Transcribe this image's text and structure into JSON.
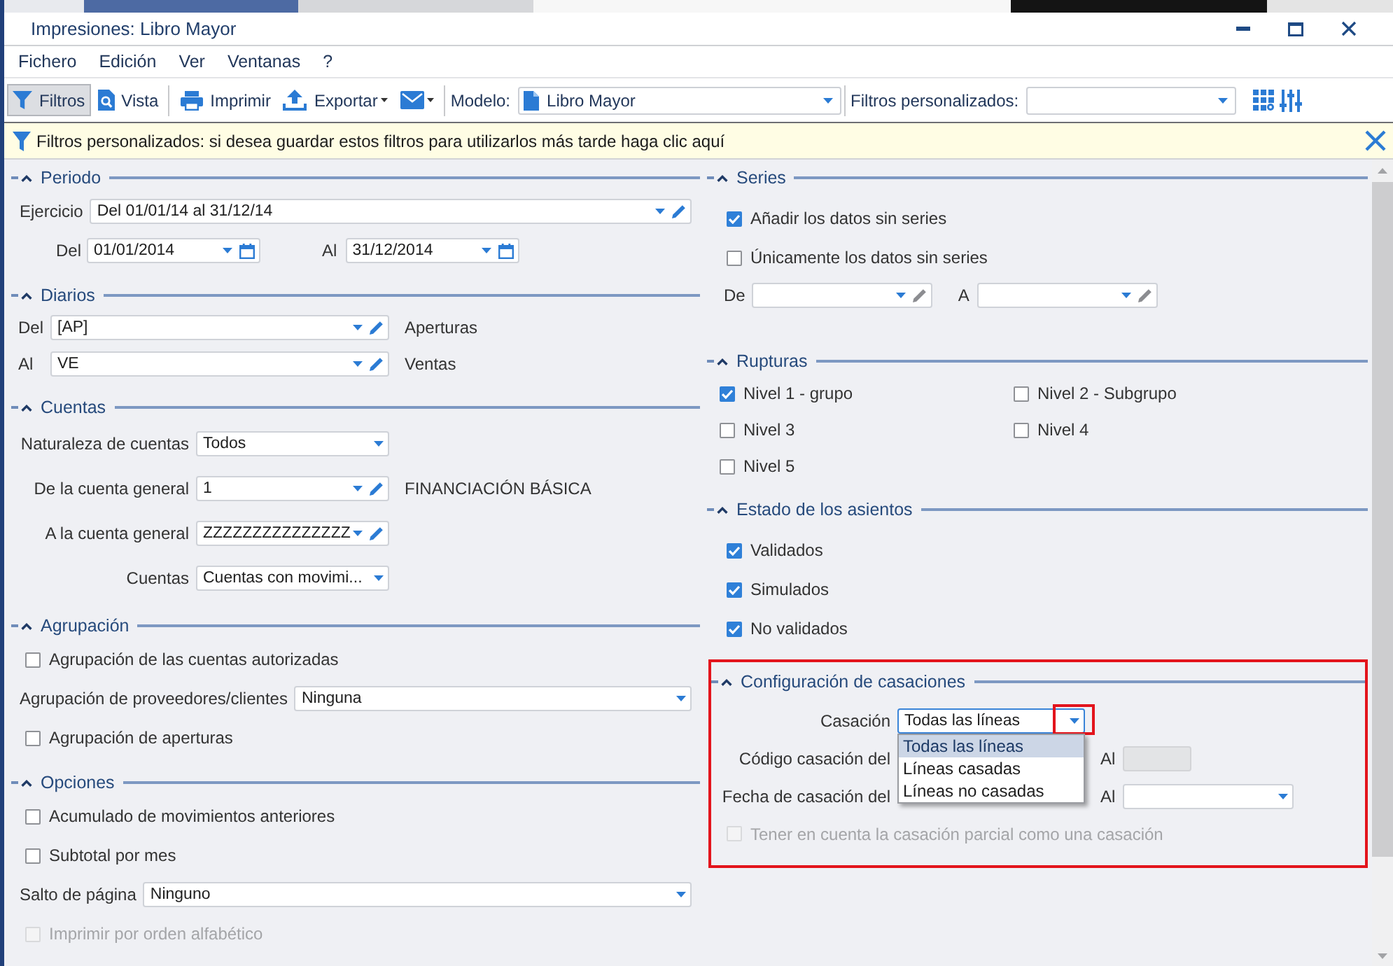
{
  "window": {
    "title": "Impresiones: Libro Mayor"
  },
  "menu": [
    "Fichero",
    "Edición",
    "Ver",
    "Ventanas",
    "?"
  ],
  "toolbar": [
    {
      "kind": "filter",
      "label": "Filtros",
      "pressed": true
    },
    {
      "kind": "preview",
      "label": "Vista",
      "pressed": false
    },
    {
      "kind": "separator"
    },
    {
      "kind": "print",
      "label": "Imprimir",
      "pressed": false
    },
    {
      "kind": "export",
      "label": "Exportar",
      "pressed": false,
      "menu": true
    },
    {
      "kind": "mail",
      "pressed": false,
      "menu": true
    },
    {
      "kind": "separator"
    },
    {
      "kind": "document-combo",
      "label": "Modelo:",
      "value": "Libro Mayor"
    },
    {
      "kind": "separator"
    },
    {
      "kind": "combo",
      "label": "Filtros personalizados:"
    },
    {
      "kind": "grid-settings"
    },
    {
      "kind": "sliders"
    }
  ],
  "info_bar": {
    "text": "Filtros personalizados: si desea guardar estos filtros para utilizarlos más tarde haga clic aquí"
  },
  "left_sections": [
    {
      "title": "Periodo",
      "expanded": true,
      "rows": [
        {
          "kind": "wide",
          "items": [
            {
              "kind": "label",
              "text": "Ejercicio"
            },
            {
              "kind": "combo-edit",
              "value": "Del 01/01/14 al 31/12/14",
              "edit_enabled": true
            }
          ]
        },
        {
          "kind": "dates",
          "items": [
            {
              "kind": "label",
              "text": "Del"
            },
            {
              "kind": "date",
              "value": "01/01/2014"
            },
            {
              "kind": "label",
              "text": "Al"
            },
            {
              "kind": "date",
              "value": "31/12/2014"
            }
          ]
        }
      ]
    },
    {
      "title": "Diarios",
      "expanded": true,
      "rows": [
        {
          "kind": "journal",
          "items": [
            {
              "kind": "label",
              "text": "Del"
            },
            {
              "kind": "combo-edit",
              "value": "[AP]",
              "edit_enabled": true
            },
            {
              "kind": "note",
              "text": "Aperturas"
            }
          ]
        },
        {
          "kind": "journal",
          "items": [
            {
              "kind": "label",
              "text": "Al"
            },
            {
              "kind": "combo-edit",
              "value": "VE",
              "edit_enabled": true
            },
            {
              "kind": "note",
              "text": "Ventas"
            }
          ]
        }
      ]
    },
    {
      "title": "Cuentas",
      "expanded": true,
      "rows": [
        {
          "kind": "account",
          "items": [
            {
              "kind": "label",
              "text": "Naturaleza de cuentas"
            },
            {
              "kind": "combo",
              "value": "Todos"
            }
          ]
        },
        {
          "kind": "account",
          "items": [
            {
              "kind": "label",
              "text": "De la cuenta general"
            },
            {
              "kind": "combo-edit",
              "value": "1",
              "edit_enabled": true
            },
            {
              "kind": "note",
              "text": "FINANCIACIÓN BÁSICA"
            }
          ]
        },
        {
          "kind": "account",
          "items": [
            {
              "kind": "label",
              "text": "A la cuenta general"
            },
            {
              "kind": "combo-edit",
              "value": "ZZZZZZZZZZZZZZZ",
              "edit_enabled": true
            }
          ]
        },
        {
          "kind": "account",
          "items": [
            {
              "kind": "label",
              "text": "Cuentas"
            },
            {
              "kind": "combo",
              "value": "Cuentas con movimi..."
            }
          ]
        }
      ]
    },
    {
      "title": "Agrupación",
      "expanded": true,
      "rows": [
        {
          "kind": "check",
          "items": [
            {
              "kind": "checkbox",
              "label": "Agrupación de las cuentas autorizadas",
              "checked": false,
              "disabled": false
            }
          ]
        },
        {
          "kind": "wide",
          "items": [
            {
              "kind": "label",
              "text": "Agrupación de proveedores/clientes"
            },
            {
              "kind": "combo",
              "value": "Ninguna"
            }
          ]
        },
        {
          "kind": "check",
          "items": [
            {
              "kind": "checkbox",
              "label": "Agrupación de aperturas",
              "checked": false,
              "disabled": false
            }
          ]
        }
      ]
    },
    {
      "title": "Opciones",
      "expanded": true,
      "rows": [
        {
          "kind": "check",
          "items": [
            {
              "kind": "checkbox",
              "label": "Acumulado de movimientos anteriores",
              "checked": false,
              "disabled": false
            }
          ]
        },
        {
          "kind": "check",
          "items": [
            {
              "kind": "checkbox",
              "label": "Subtotal por mes",
              "checked": false,
              "disabled": false
            }
          ]
        },
        {
          "kind": "wide",
          "items": [
            {
              "kind": "label",
              "text": "Salto de página"
            },
            {
              "kind": "combo",
              "value": "Ninguno"
            }
          ]
        },
        {
          "kind": "check",
          "items": [
            {
              "kind": "checkbox",
              "label": "Imprimir por orden alfabético",
              "checked": false,
              "disabled": true
            }
          ]
        }
      ]
    }
  ],
  "right_sections": [
    {
      "title": "Series",
      "expanded": true,
      "rows": [
        {
          "kind": "check",
          "items": [
            {
              "kind": "checkbox",
              "label": "Añadir los datos sin series",
              "checked": true,
              "disabled": false
            }
          ]
        },
        {
          "kind": "check",
          "items": [
            {
              "kind": "checkbox",
              "label": "Únicamente los datos sin series",
              "checked": false,
              "disabled": false
            }
          ]
        },
        {
          "kind": "range",
          "items": [
            {
              "kind": "label",
              "text": "De"
            },
            {
              "kind": "combo-edit",
              "edit_enabled": false
            },
            {
              "kind": "label",
              "text": "A"
            },
            {
              "kind": "combo-edit",
              "edit_enabled": false
            }
          ]
        }
      ]
    },
    {
      "title": "Rupturas",
      "expanded": true,
      "rows": [
        {
          "kind": "grid",
          "items": [
            {
              "kind": "checkbox",
              "label": "Nivel 1 - grupo",
              "checked": true,
              "disabled": false
            },
            {
              "kind": "checkbox",
              "label": "Nivel 2 - Subgrupo",
              "checked": false,
              "disabled": false
            },
            {
              "kind": "checkbox",
              "label": "Nivel 3",
              "checked": false,
              "disabled": false
            },
            {
              "kind": "checkbox",
              "label": "Nivel 4",
              "checked": false,
              "disabled": false
            },
            {
              "kind": "checkbox",
              "label": "Nivel 5",
              "checked": false,
              "disabled": false
            }
          ]
        }
      ]
    },
    {
      "title": "Estado de los asientos",
      "expanded": true,
      "rows": [
        {
          "kind": "check",
          "items": [
            {
              "kind": "checkbox",
              "label": "Validados",
              "checked": true,
              "disabled": false
            }
          ]
        },
        {
          "kind": "check",
          "items": [
            {
              "kind": "checkbox",
              "label": "Simulados",
              "checked": true,
              "disabled": false
            }
          ]
        },
        {
          "kind": "check",
          "items": [
            {
              "kind": "checkbox",
              "label": "No validados",
              "checked": true,
              "disabled": false
            }
          ]
        }
      ]
    },
    {
      "title": "Configuración de casaciones",
      "expanded": true,
      "highlighted": true,
      "rows": [
        {
          "kind": "match",
          "items": [
            {
              "kind": "label",
              "text": "Casación"
            },
            {
              "kind": "combo",
              "value": "Todas las líneas",
              "focused": true,
              "highlighted": true,
              "open": true,
              "options": [
                {
                  "label": "Todas las líneas",
                  "selected": true
                },
                {
                  "label": "Líneas casadas",
                  "selected": false
                },
                {
                  "label": "Líneas no casadas",
                  "selected": false
                }
              ]
            }
          ]
        },
        {
          "kind": "match-covered",
          "items": [
            {
              "kind": "label",
              "text": "Código casación del"
            },
            {
              "kind": "label",
              "text": "Al"
            },
            {
              "kind": "text-field",
              "disabled": true
            }
          ]
        },
        {
          "kind": "match-covered",
          "items": [
            {
              "kind": "label",
              "text": "Fecha de casación del"
            },
            {
              "kind": "label",
              "text": "Al"
            },
            {
              "kind": "combo"
            }
          ]
        },
        {
          "kind": "check",
          "items": [
            {
              "kind": "checkbox",
              "label": "Tener en cuenta la casación parcial como una casación",
              "checked": false,
              "disabled": true
            }
          ]
        }
      ]
    }
  ]
}
